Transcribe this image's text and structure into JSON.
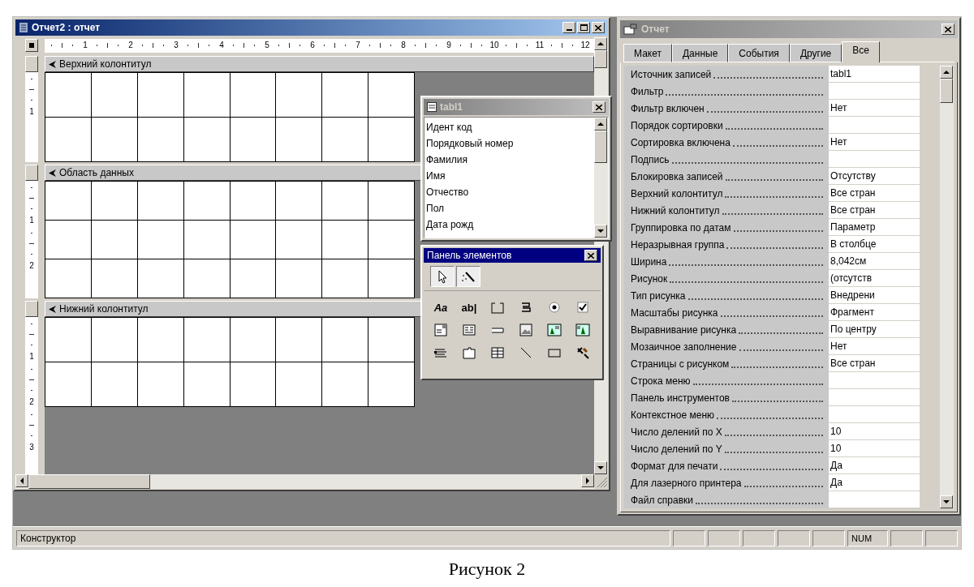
{
  "report_window": {
    "title": "Отчет2 : отчет",
    "active": true,
    "ruler_marks": [
      "1",
      "2",
      "3",
      "4",
      "5",
      "6",
      "7",
      "8",
      "9",
      "10",
      "11",
      "12"
    ],
    "sections": [
      {
        "label": "Верхний колонтитул",
        "ruler_marks": [
          "1"
        ]
      },
      {
        "label": "Область данных",
        "ruler_marks": [
          "1",
          "2"
        ]
      },
      {
        "label": "Нижний колонтитул",
        "ruler_marks": [
          "1",
          "2",
          "3"
        ]
      }
    ]
  },
  "field_list": {
    "title": "tabl1",
    "active": false,
    "fields": [
      "Идент код",
      "Порядковый номер",
      "Фамилия",
      "Имя",
      "Отчество",
      "Пол",
      "Дата рожд"
    ]
  },
  "toolbox": {
    "title": "Панель элементов",
    "active": true,
    "top_tools": [
      {
        "kind": "pointer"
      },
      {
        "kind": "wizard"
      }
    ],
    "tools": [
      {
        "kind": "label",
        "glyph": "Aa"
      },
      {
        "kind": "textbox",
        "glyph": "ab|"
      },
      {
        "kind": "option-group"
      },
      {
        "kind": "toggle"
      },
      {
        "kind": "radio"
      },
      {
        "kind": "checkbox"
      },
      {
        "kind": "combo"
      },
      {
        "kind": "listbox"
      },
      {
        "kind": "command"
      },
      {
        "kind": "image"
      },
      {
        "kind": "unbound-frame"
      },
      {
        "kind": "bound-frame"
      },
      {
        "kind": "page-break"
      },
      {
        "kind": "tab-control"
      },
      {
        "kind": "subreport"
      },
      {
        "kind": "line"
      },
      {
        "kind": "rectangle"
      },
      {
        "kind": "more"
      }
    ]
  },
  "properties_window": {
    "title": "Отчет",
    "active": false,
    "tabs": [
      {
        "label": "Макет",
        "selected": false
      },
      {
        "label": "Данные",
        "selected": false
      },
      {
        "label": "События",
        "selected": false
      },
      {
        "label": "Другие",
        "selected": false
      },
      {
        "label": "Все",
        "selected": true
      }
    ],
    "rows": [
      {
        "label": "Источник записей",
        "value": "tabl1"
      },
      {
        "label": "Фильтр"
      },
      {
        "label": "Фильтр включен",
        "value": "Нет"
      },
      {
        "label": "Порядок сортировки"
      },
      {
        "label": "Сортировка включена",
        "value": "Нет"
      },
      {
        "label": "Подпись"
      },
      {
        "label": "Блокировка записей",
        "value": "Отсутству"
      },
      {
        "label": "Верхний колонтитул",
        "value": "Все стран"
      },
      {
        "label": "Нижний колонтитул",
        "value": "Все стран"
      },
      {
        "label": "Группировка по датам",
        "value": "Параметр"
      },
      {
        "label": "Неразрывная группа",
        "value": "В столбце"
      },
      {
        "label": "Ширина",
        "value": "8,042см"
      },
      {
        "label": "Рисунок",
        "value": "(отсутств"
      },
      {
        "label": "Тип рисунка",
        "value": "Внедрени"
      },
      {
        "label": "Масштабы рисунка",
        "value": "Фрагмент"
      },
      {
        "label": "Выравнивание рисунка",
        "value": "По центру"
      },
      {
        "label": "Мозаичное заполнение",
        "value": "Нет"
      },
      {
        "label": "Страницы с рисунком",
        "value": "Все стран"
      },
      {
        "label": "Строка меню"
      },
      {
        "label": "Панель инструментов"
      },
      {
        "label": "Контекстное меню"
      },
      {
        "label": "Число делений по X",
        "value": "10"
      },
      {
        "label": "Число делений по Y",
        "value": "10"
      },
      {
        "label": "Формат для печати",
        "value": "Да"
      },
      {
        "label": "Для лазерного принтера",
        "value": "Да"
      },
      {
        "label": "Файл справки"
      }
    ]
  },
  "status_bar": {
    "text": "Конструктор",
    "indicators": [
      "NUM"
    ]
  },
  "caption": "Рисунок 2"
}
